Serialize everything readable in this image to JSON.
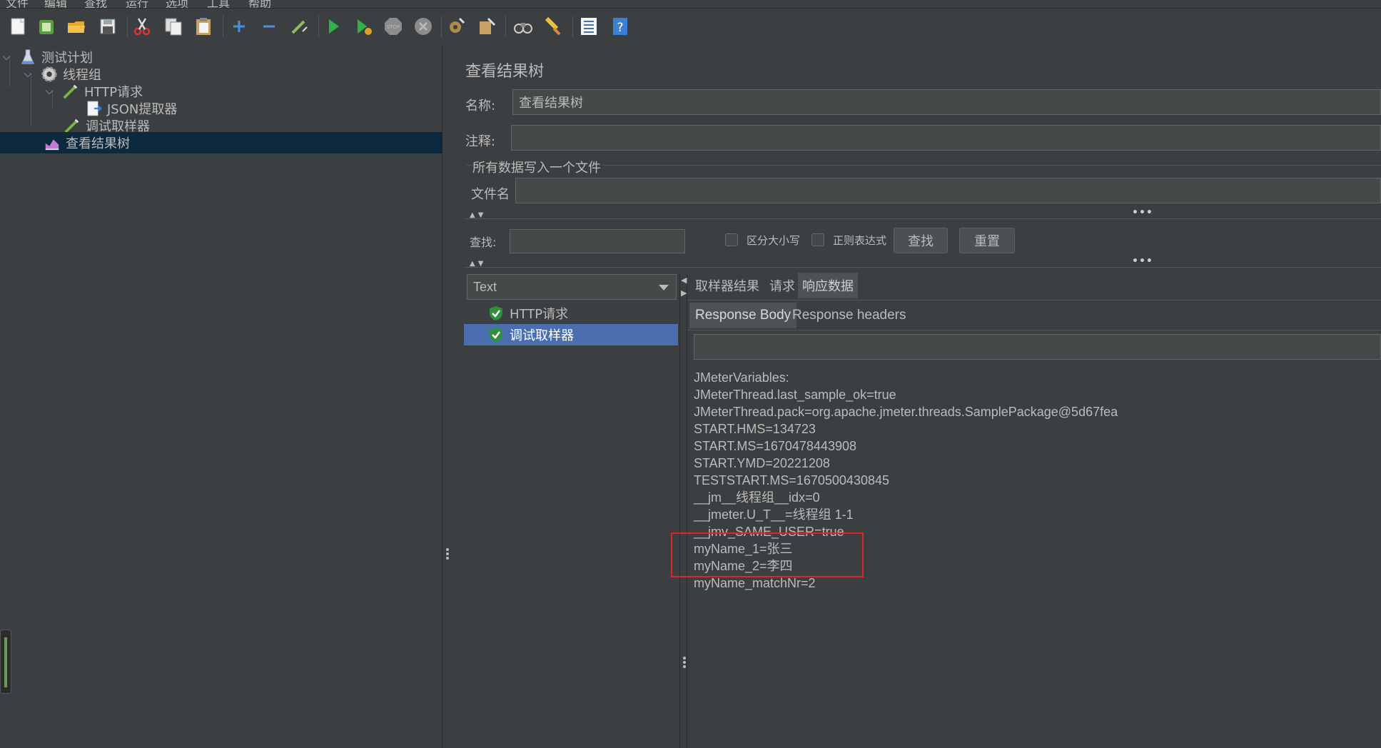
{
  "menubar": {
    "items": [
      "文件",
      "编辑",
      "查找",
      "运行",
      "选项",
      "工具",
      "帮助"
    ]
  },
  "toolbar": {
    "icons": [
      "new-icon",
      "templates-icon",
      "open-icon",
      "save-icon",
      "cut-icon",
      "copy-icon",
      "paste-icon",
      "expand-icon",
      "collapse-icon",
      "toggle-icon",
      "start-icon",
      "start-no-pause-icon",
      "stop-icon",
      "shutdown-icon",
      "clear-icon",
      "clear-all-icon",
      "search-icon",
      "reset-search-icon",
      "function-helper-icon",
      "help-icon"
    ]
  },
  "tree": {
    "items": [
      {
        "label": "测试计划",
        "icon": "test-plan-icon"
      },
      {
        "label": "线程组",
        "icon": "thread-group-icon"
      },
      {
        "label": "HTTP请求",
        "icon": "sampler-icon"
      },
      {
        "label": "JSON提取器",
        "icon": "extractor-icon"
      },
      {
        "label": "调试取样器",
        "icon": "sampler-icon"
      },
      {
        "label": "查看结果树",
        "icon": "listener-icon"
      }
    ]
  },
  "panel": {
    "title": "查看结果树",
    "name_label": "名称:",
    "name_value": "查看结果树",
    "comment_label": "注释:",
    "comment_value": "",
    "file_section": "所有数据写入一个文件",
    "filename_label": "文件名",
    "filename_value": "",
    "search_label": "查找:",
    "search_value": "",
    "case_label": "区分大小写",
    "regex_label": "正则表达式",
    "find_button": "查找",
    "reset_button": "重置"
  },
  "results": {
    "renderer": "Text",
    "items": [
      {
        "label": "HTTP请求",
        "status": "success"
      },
      {
        "label": "调试取样器",
        "status": "success"
      }
    ],
    "selected_index": 1
  },
  "tabs": {
    "main": [
      "取样器结果",
      "请求",
      "响应数据"
    ],
    "active_main": 2,
    "sub": [
      "Response Body",
      "Response headers"
    ],
    "active_sub": 0
  },
  "response_body": {
    "lines": [
      "JMeterVariables:",
      "JMeterThread.last_sample_ok=true",
      "JMeterThread.pack=org.apache.jmeter.threads.SamplePackage@5d67fea",
      "START.HMS=134723",
      "START.MS=1670478443908",
      "START.YMD=20221208",
      "TESTSTART.MS=1670500430845",
      "__jm__线程组__idx=0",
      "__jmeter.U_T__=线程组 1-1",
      "__jmv_SAME_USER=true",
      "myName_1=张三",
      "myName_2=李四",
      "myName_matchNr=2"
    ]
  },
  "colors": {
    "background": "#3c3f41",
    "selection": "#4b6eaf",
    "tree_selection": "#0d293e",
    "highlight_box": "#e0242b"
  }
}
